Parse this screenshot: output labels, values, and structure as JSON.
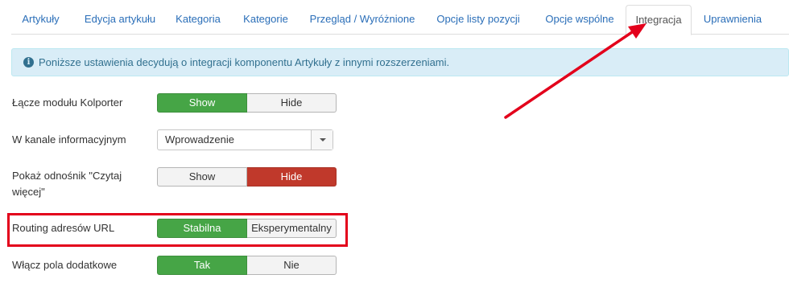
{
  "tabs": [
    {
      "label": "Artykuły"
    },
    {
      "label": "Edycja artykułu"
    },
    {
      "label": "Kategoria"
    },
    {
      "label": "Kategorie"
    },
    {
      "label": "Przegląd / Wyróżnione"
    },
    {
      "label": "Opcje listy pozycji"
    },
    {
      "label": "Opcje wspólne"
    },
    {
      "label": "Integracja"
    },
    {
      "label": "Uprawnienia"
    }
  ],
  "active_tab": "Integracja",
  "alert": {
    "icon": "info-icon",
    "text": "Poniższe ustawienia decydują o integracji komponentu Artykuły z innymi rozszerzeniami."
  },
  "fields": {
    "kolporter": {
      "label": "Łącze modułu Kolporter",
      "options": [
        "Show",
        "Hide"
      ],
      "selected": "Show"
    },
    "feed": {
      "label": "W kanale informacyjnym",
      "value": "Wprowadzenie"
    },
    "readmore": {
      "label": "Pokaż odnośnik \"Czytaj więcej\"",
      "options": [
        "Show",
        "Hide"
      ],
      "selected": "Hide"
    },
    "routing": {
      "label": "Routing adresów URL",
      "options": [
        "Stabilna",
        "Eksperymentalny"
      ],
      "selected": "Stabilna"
    },
    "custom_fields": {
      "label": "Włącz pola dodatkowe",
      "options": [
        "Tak",
        "Nie"
      ],
      "selected": "Tak"
    }
  },
  "colors": {
    "tab_link": "#2a6eb8",
    "alert_bg": "#d9edf7",
    "alert_text": "#31708f",
    "btn_green": "#46a546",
    "btn_red": "#c0392b",
    "annotation": "#e3001b"
  }
}
